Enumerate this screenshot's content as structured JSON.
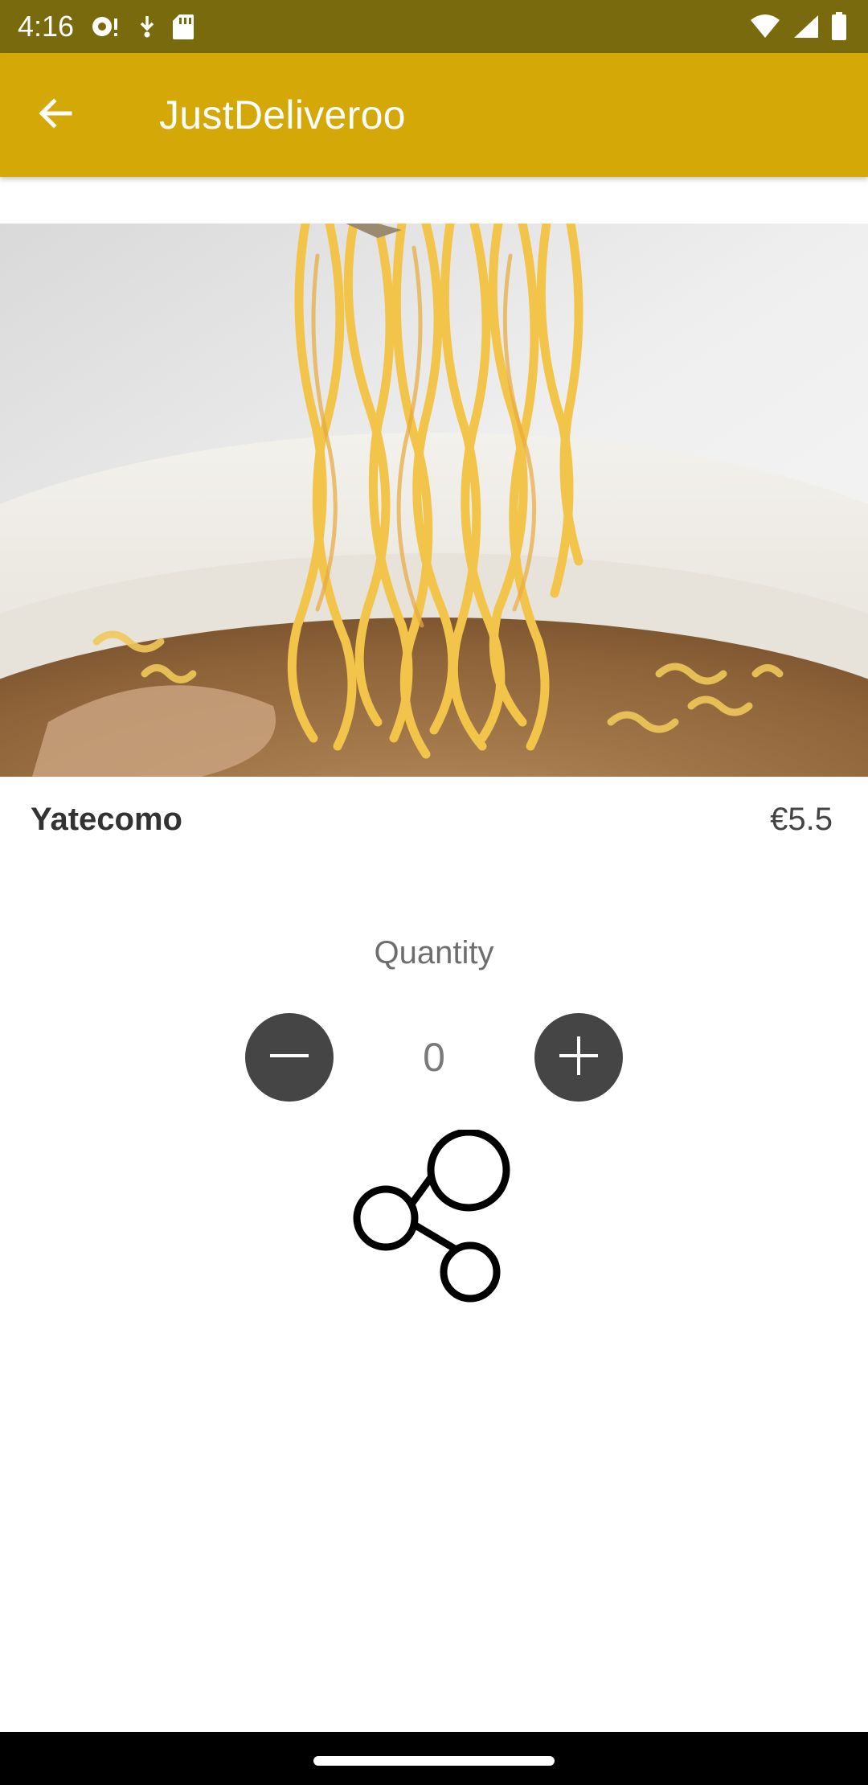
{
  "status_bar": {
    "time": "4:16",
    "left_icons": [
      "sync-icon",
      "download-icon",
      "sd-card-icon"
    ],
    "right_icons": [
      "wifi-icon",
      "signal-icon",
      "battery-icon"
    ]
  },
  "app_bar": {
    "back_icon": "arrow-back-icon",
    "title": "JustDeliveroo"
  },
  "item": {
    "image": "ramen-noodles-photo",
    "name": "Yatecomo",
    "price": "€5.5"
  },
  "quantity": {
    "label": "Quantity",
    "value": "0",
    "decrease_icon": "minus-icon",
    "increase_icon": "plus-icon"
  },
  "share": {
    "icon": "share-icon"
  },
  "colors": {
    "status_bar": "#7a6a0e",
    "app_bar": "#d4a806",
    "qty_button": "#454545"
  }
}
